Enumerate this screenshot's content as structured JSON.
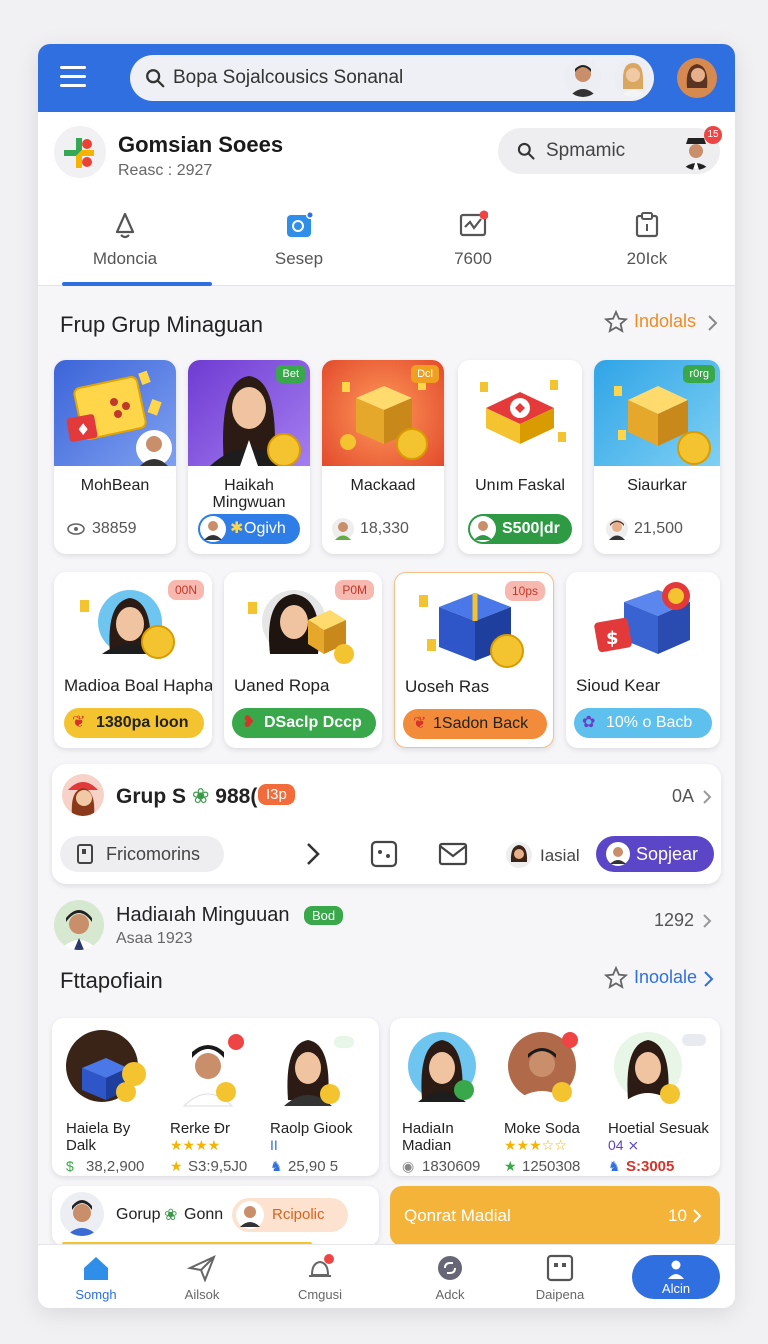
{
  "topbar": {
    "search_text": "Bopa Sojalcousics Sonanal"
  },
  "header": {
    "title": "Gomsian Soees",
    "subtitle": "Reasc : 2927",
    "search_text": "Spmamic",
    "badge": "15"
  },
  "tabs": [
    {
      "label": "Mdoncia",
      "icon": "bell-icon"
    },
    {
      "label": "Sesep",
      "icon": "camera-icon"
    },
    {
      "label": "7600",
      "icon": "chart-icon"
    },
    {
      "label": "20Ick",
      "icon": "clipboard-icon"
    }
  ],
  "section1": {
    "title": "Frup Grup Minaguan",
    "link": "Indolals",
    "cards": [
      {
        "name": "MohBean",
        "meta": "38859",
        "badge": ""
      },
      {
        "name": "Haikah Mingwuan",
        "pill": "Ogivh",
        "badge": "Bet"
      },
      {
        "name": "Mackaad",
        "meta": "18,330",
        "badge": "Dcl"
      },
      {
        "name": "Unım Faskal",
        "pill": "S500|dr",
        "badge": ""
      },
      {
        "name": "Siaurkar",
        "meta": "21,500",
        "badge": "r0rg"
      }
    ]
  },
  "section2": {
    "cards": [
      {
        "name": "Madioa Boal Hapha",
        "pill": "1380pa loon",
        "badge": "00N"
      },
      {
        "name": "Uaned Ropa",
        "pill": "DSaclp Dccp",
        "badge": "P0M"
      },
      {
        "name": "Uoseh Ras",
        "pill": "1Sadon Back",
        "badge": "10ps"
      },
      {
        "name": "Sioud Kear",
        "pill": "10% o Bacb",
        "badge": ""
      }
    ]
  },
  "group": {
    "title": "Grup S",
    "count": "988(",
    "tag": "I3p",
    "right": "0A",
    "filter": "Fricomorins",
    "user": "Iasial",
    "button": "Sopjear"
  },
  "person_row": {
    "name": "Hadiaıah Minguuan",
    "tag": "Bod",
    "sub": "Asaa 1923",
    "right": "1292"
  },
  "section3": {
    "title": "Fttapofiain",
    "link": "Inoolale"
  },
  "people_left": [
    {
      "name": "Haiela By",
      "name2": "Dalk",
      "value": "38,2,900",
      "stars": ""
    },
    {
      "name": "Rerke Ðr",
      "stars": "★★★★",
      "value": "S3:9,5J0"
    },
    {
      "name": "Raolp Giook",
      "stars": "II",
      "value": "25,90 5"
    }
  ],
  "people_right": [
    {
      "name": "HadiaIn",
      "name2": "Madian",
      "value": "1830609",
      "stars": ""
    },
    {
      "name": "Moke Soda",
      "stars": "★★★☆☆",
      "value": "1250308"
    },
    {
      "name": "Hoetial Sesuak",
      "stars": "04 ⨯",
      "value": "S:3005"
    }
  ],
  "bottom_group": {
    "label": "Gorup",
    "label2": "Gonn",
    "pill": "Rcipolic"
  },
  "bottom_banner": {
    "label": "Qonrat Madial",
    "count": "10"
  },
  "nav": [
    {
      "label": "Somgh",
      "icon": "home-icon"
    },
    {
      "label": "Ailsok",
      "icon": "send-icon"
    },
    {
      "label": "Cmgusi",
      "icon": "bell-icon"
    },
    {
      "label": "Adck",
      "icon": "refresh-icon"
    },
    {
      "label": "Daipena",
      "icon": "grid-icon"
    },
    {
      "label": "Alcin",
      "icon": "person-icon"
    }
  ],
  "colors": {
    "primary": "#2f6fe0",
    "orange": "#f0a020",
    "green": "#34a853",
    "red": "#ef4444",
    "purple": "#5b46c8"
  }
}
